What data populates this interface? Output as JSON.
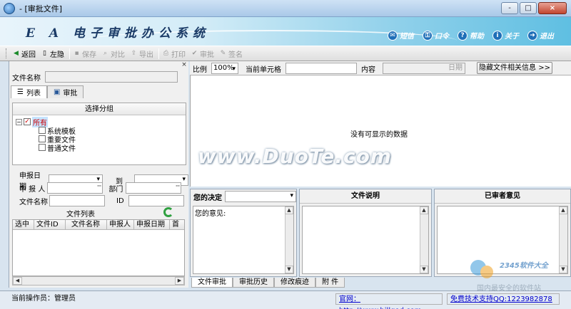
{
  "window": {
    "title": "- [审批文件]",
    "buttons": {
      "minimize": "-",
      "maximize": "□",
      "close": "×"
    }
  },
  "banner": {
    "title": "E A 电子审批办公系统",
    "nav": [
      {
        "label": "短信",
        "icon": "message-icon"
      },
      {
        "label": "口令",
        "icon": "key-icon"
      },
      {
        "label": "帮助",
        "icon": "help-icon"
      },
      {
        "label": "关于",
        "icon": "info-icon"
      },
      {
        "label": "退出",
        "icon": "exit-icon"
      }
    ]
  },
  "toolbar": {
    "back": "返回",
    "hide_left": "左隐",
    "save": "保存",
    "compare": "对比",
    "export": "导出",
    "print": "打印",
    "approve": "审批",
    "sign": "签名"
  },
  "left": {
    "close_glyph": "×",
    "file_name_label": "文件名称",
    "tabs": [
      "列表",
      "审批"
    ],
    "group": {
      "title": "选择分组",
      "root": "所有",
      "children": [
        "系统模板",
        "重要文件",
        "普通文件"
      ]
    },
    "filters": {
      "date_label": "申报日期",
      "to_label": "到",
      "reporter_label": "申 报 人",
      "dept_label": "部门",
      "file_name_label": "文件名称",
      "id_label": "ID"
    },
    "list_title": "文件列表",
    "columns": [
      "选中",
      "文件ID",
      "文件名称",
      "申报人",
      "申报日期",
      "首"
    ]
  },
  "right": {
    "scale_label": "比例",
    "scale_value": "100%",
    "cell_label": "当前单元格",
    "content_label": "内容",
    "date_placeholder": "日期",
    "hide_info_button": "隐藏文件相关信息 >>",
    "empty_message": "没有可显示的数据",
    "watermark": "www.DuoTe.com",
    "decision_label": "您的决定",
    "opinion_label": "您的意见:",
    "file_desc_header": "文件说明",
    "reviewer_header": "已审者意见",
    "tabs": [
      "文件审批",
      "审批历史",
      "修改痕迹",
      "附 件"
    ]
  },
  "status": {
    "operator": "当前操作员：管理员",
    "website": "官网：http://www.billgod.com",
    "support": "免费技术支持QQ:1223982878",
    "site_watermark": "2345软件大全",
    "watermark_slogan": "国内最安全的软件站"
  }
}
